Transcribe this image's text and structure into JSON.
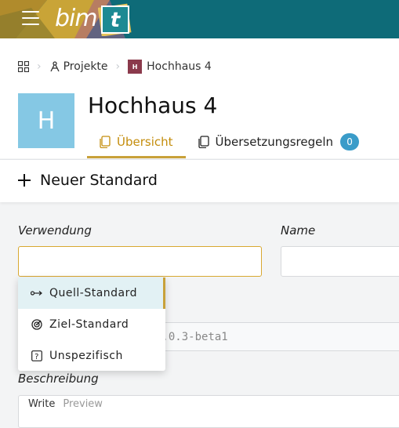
{
  "app": {
    "logo_text": "bim",
    "logo_badge": "t"
  },
  "colors": {
    "topbar": "#0e6b78",
    "accent": "#c8a13a",
    "avatar": "#85c8e4",
    "badge": "#3a9cc9"
  },
  "breadcrumb": {
    "home_icon": "grid-icon",
    "projects_label": "Projekte",
    "project_badge": "H",
    "project_label": "Hochhaus 4"
  },
  "project": {
    "avatar_letter": "H",
    "title": "Hochhaus 4"
  },
  "tabs": [
    {
      "label": "Übersicht",
      "icon": "copy-icon",
      "active": true
    },
    {
      "label": "Übersetzungsregeln",
      "icon": "copy-icon",
      "count": "0"
    }
  ],
  "new_standard": {
    "title": "Neuer Standard"
  },
  "form": {
    "usage_label": "Verwendung",
    "usage_value": "",
    "name_label": "Name",
    "name_value": "",
    "version_value": "0.0.3-beta1",
    "description_label": "Beschreibung",
    "editor_tabs": [
      "Write",
      "Preview"
    ]
  },
  "dropdown": {
    "options": [
      {
        "label": "Quell-Standard",
        "icon": "source-arrow-icon",
        "selected": true
      },
      {
        "label": "Ziel-Standard",
        "icon": "target-icon"
      },
      {
        "label": "Unspezifisch",
        "icon": "question-icon"
      }
    ]
  }
}
